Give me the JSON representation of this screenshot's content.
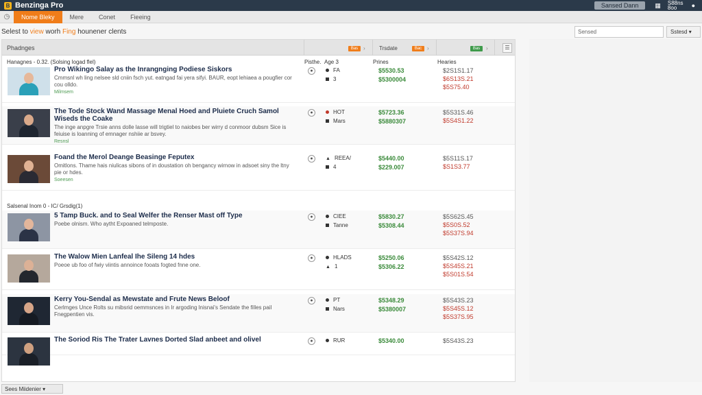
{
  "topbar": {
    "logo_mark": "B",
    "logo_text": "Benzinga Pro",
    "account_button": "Sansed Dann",
    "user_line1": "S88ns",
    "user_line2": "8oo"
  },
  "nav": {
    "items": [
      {
        "label": "Nome Bleky",
        "active": true
      },
      {
        "label": "Mere",
        "active": false
      },
      {
        "label": "Conet",
        "active": false
      },
      {
        "label": "Fieeing",
        "active": false
      }
    ]
  },
  "filter": {
    "text_before": "Selest to",
    "accent1": "view",
    "text_mid": "worh",
    "accent2": "Fing",
    "text_after": "hounener clents",
    "search_value": "Sensed",
    "select_label": "Sstesd"
  },
  "panel": {
    "title": "Phadnges",
    "tab1_badge": "Bas",
    "tab2_label": "Trsdate",
    "tab2_badge": "Bac",
    "tab3_badge": "Bas",
    "columns": {
      "col1": "Pisthe.",
      "col2": "Age 3",
      "col3": "Prines",
      "col4": "Hearies"
    }
  },
  "sections": [
    {
      "label": "Hanagnes - 0.32. (Solsing logad flel)"
    },
    {
      "label": "Salsenal Inom 0 - IC/ Grsdig(1)"
    }
  ],
  "stories": [
    {
      "title": "Pro Wikingo Salay as the Inrangnging Podiese Siskors",
      "desc": "Cmmsnl wh ling nelsee sld cniin fsch yut. eatngad fai yera sifyi. BAUR, eopt lehiaea a pougfier cor cou olldo.",
      "source": "Milmsem",
      "tag1": "FA",
      "tag2": "3",
      "tag1_icon": "dot",
      "tag2_icon": "square",
      "prices": [
        "$5530.53",
        "$5300004"
      ],
      "highs": [
        "$2S1S1.17",
        "$6S13S.21",
        "$5S75.40"
      ],
      "thumb_bg": "#cfe0ea",
      "thumb_body": "#2aa0b8",
      "thumb_skin": "#e6b89a"
    },
    {
      "title": "The Tode Stock Wand Massage Menal Hoed and Pluiete Cruch Samol Wiseds the Coake",
      "desc": "The inge anpgre Trsie anns dolle lasse will trigtiel to naiobes ber wirry d conmoor dubsm Sice is feiuise is loanning of emnager nshiie ar bsvey.",
      "source": "Resnsl",
      "tag1": "HOT",
      "tag2": "Mars",
      "tag1_icon": "red",
      "tag2_icon": "square",
      "prices": [
        "$5723.36",
        "$5880307"
      ],
      "highs": [
        "$5S31S.46",
        "$5S4S1.22"
      ],
      "thumb_bg": "#3a3f4a",
      "thumb_body": "#1e2530",
      "thumb_skin": "#d9a98a"
    },
    {
      "title": "Foand the Merol Deange Beasinge Feputex",
      "desc": "Omitlons. Thame hais niulicas sibons of in doustation oh bengancy wirnow in adsoet siny the ltny pie or hdes.",
      "source": "Soeesen",
      "tag1": "REEA/",
      "tag2": "4",
      "tag1_icon": "up",
      "tag2_icon": "square",
      "prices": [
        "$5440.00",
        "$229.007"
      ],
      "highs": [
        "$5S11S.17",
        "$S1S3.77"
      ],
      "thumb_bg": "#6b4a38",
      "thumb_body": "#2a2a33",
      "thumb_skin": "#e0b294"
    },
    {
      "title": "5 Tamp Buck. and to Seal Welfer the Renser Mast off Type",
      "desc": "Poebe olnism. Who aytht Expoaned telmposte.",
      "source": "",
      "tag1": "CIEE",
      "tag2": "Tanne",
      "tag1_icon": "dot",
      "tag2_icon": "square",
      "prices": [
        "$5830.27",
        "$5308.44"
      ],
      "highs": [
        "$5S62S.45",
        "$5S0S.52",
        "$5S37S.94"
      ],
      "thumb_bg": "#8d95a3",
      "thumb_body": "#2b3346",
      "thumb_skin": "#e3b69b"
    },
    {
      "title": "The Walow Mien Lanfeal Ihe Sileng 14 hdes",
      "desc": "Poeoe ub foo of fwiy viintis annoince fooats fogted fnne one.",
      "source": "",
      "tag1": "HLADS",
      "tag2": "1",
      "tag1_icon": "dot",
      "tag2_icon": "up",
      "prices": [
        "$5250.06",
        "$5306.22"
      ],
      "highs": [
        "$5S42S.12",
        "$5S45S.21",
        "$5S01S.54"
      ],
      "thumb_bg": "#b5a89c",
      "thumb_body": "#23272e",
      "thumb_skin": "#dcb196"
    },
    {
      "title": "Kerry You-Sendal as Mewstate and Frute News Beloof",
      "desc": "Cerlmges Unce Rolts su mibsrid oemmsnces in Ir argoding lnisnai's Sendate the filles pail Fnegpentien vis.",
      "source": "",
      "tag1": "PT",
      "tag2": "Nars",
      "tag1_icon": "dot",
      "tag2_icon": "square",
      "prices": [
        "$5348.29",
        "$5380007"
      ],
      "highs": [
        "$5S43S.23",
        "$5S45S.12",
        "$5S37S.95"
      ],
      "thumb_bg": "#1f2733",
      "thumb_body": "#151a22",
      "thumb_skin": "#d6a588"
    },
    {
      "title": "The Soriod Ris The Trater Lavnes Dorted Slad anbeet and olivel",
      "desc": "",
      "source": "",
      "tag1": "RUR",
      "tag2": "",
      "tag1_icon": "dot",
      "tag2_icon": "",
      "prices": [
        "$5340.00"
      ],
      "highs": [
        "$5S43S.23"
      ],
      "thumb_bg": "#2c3440",
      "thumb_body": "#1a1f27",
      "thumb_skin": "#cfa080"
    }
  ],
  "footer": {
    "button_label": "Sees Miidenier"
  }
}
